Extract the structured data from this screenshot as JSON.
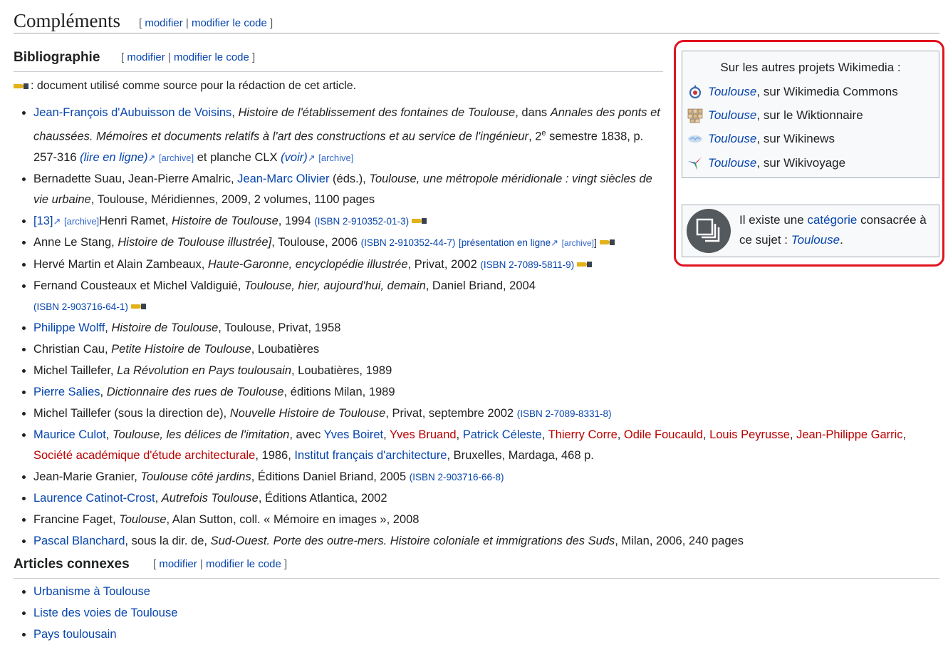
{
  "complements": {
    "title": "Compléments",
    "open": "[",
    "modifier": "modifier",
    "sep": "|",
    "modifier_code": "modifier le code",
    "close": "]"
  },
  "bibliographie": {
    "title": "Bibliographie",
    "open": "[",
    "modifier": "modifier",
    "sep": "|",
    "modifier_code": "modifier le code",
    "close": "]"
  },
  "note": ": document utilisé comme source pour la rédaction de cet article.",
  "items": {
    "i1": {
      "a1": "Jean-François d'Aubuisson de Voisins",
      "t1": ", ",
      "e1": "Histoire de l'établissement des fontaines de Toulouse",
      "t2": ", dans ",
      "e2": "Annales des ponts et chaussées. Mémoires et documents relatifs à l'art des constructions et au service de l'ingénieur",
      "t3": ", 2",
      "sup": "e",
      "t4": " semestre 1838, p. 257-316 ",
      "l1": "(lire en ligne)",
      "ar1": "[archive]",
      "t5": " et planche CLX ",
      "l2": "(voir)",
      "ar2": "[archive]"
    },
    "i2": {
      "t1": "Bernadette Suau, Jean-Pierre Amalric, ",
      "a1": "Jean-Marc Olivier",
      "t2": " (éds.), ",
      "e1": "Toulouse, une métropole méridionale : vingt siècles de vie urbaine",
      "t3": ", Toulouse, Méridiennes, 2009, 2 volumes, 1100 pages"
    },
    "i3": {
      "l1": "[13]",
      "ar1": "[archive]",
      "t1": "Henri Ramet, ",
      "e1": "Histoire de Toulouse",
      "t2": ", 1994 ",
      "isbn": "(ISBN 2-910352-01-3)"
    },
    "i4": {
      "t1": "Anne Le Stang, ",
      "e1": "Histoire de Toulouse illustrée]",
      "t2": ", Toulouse, 2006 ",
      "isbn": "(ISBN 2-910352-44-7)",
      "pres": "[présentation en ligne",
      "ar1": "[archive]",
      "close": "]"
    },
    "i5": {
      "t1": "Hervé Martin et Alain Zambeaux, ",
      "e1": "Haute-Garonne, encyclopédie illustrée",
      "t2": ", Privat, 2002 ",
      "isbn": "(ISBN 2-7089-5811-9)"
    },
    "i6": {
      "t1": "Fernand Cousteaux et Michel Valdiguié, ",
      "e1": "Toulouse, hier, aujourd'hui, demain",
      "t2": ", Daniel Briand, 2004",
      "isbn": "(ISBN 2-903716-64-1)"
    },
    "i7": {
      "a1": "Philippe Wolff",
      "t1": ", ",
      "e1": "Histoire de Toulouse",
      "t2": ", Toulouse, Privat, 1958"
    },
    "i8": {
      "t1": "Christian Cau, ",
      "e1": "Petite Histoire de Toulouse",
      "t2": ", Loubatières"
    },
    "i9": {
      "t1": "Michel Taillefer, ",
      "e1": "La Révolution en Pays toulousain",
      "t2": ", Loubatières, 1989"
    },
    "i10": {
      "a1": "Pierre Salies",
      "t1": ", ",
      "e1": "Dictionnaire des rues de Toulouse",
      "t2": ", éditions Milan, 1989"
    },
    "i11": {
      "t1": "Michel Taillefer (sous la direction de), ",
      "e1": "Nouvelle Histoire de Toulouse",
      "t2": ", Privat, septembre 2002 ",
      "isbn": "(ISBN 2-7089-8331-8)"
    },
    "i12": {
      "a1": "Maurice Culot",
      "t1": ", ",
      "e1": "Toulouse, les délices de l'imitation",
      "t2": ", avec ",
      "a2": "Yves Boiret",
      "c1": ", ",
      "r1": "Yves Bruand",
      "c2": ", ",
      "a3": "Patrick Céleste",
      "c3": ", ",
      "r2": "Thierry Corre",
      "c4": ", ",
      "r3": "Odile Foucauld",
      "c5": ", ",
      "r4": "Louis Peyrusse",
      "c6": ", ",
      "r5": "Jean-Philippe Garric",
      "c7": ", ",
      "r6": "Société académique d'étude architecturale",
      "t3": ", 1986, ",
      "a4": "Institut français d'architecture",
      "t4": ", Bruxelles, Mardaga, 468 p."
    },
    "i13": {
      "t1": "Jean-Marie Granier, ",
      "e1": "Toulouse côté jardins",
      "t2": ", Éditions Daniel Briand, 2005 ",
      "isbn": "(ISBN 2-903716-66-8)"
    },
    "i14": {
      "a1": "Laurence Catinot-Crost",
      "t1": ", ",
      "e1": "Autrefois Toulouse",
      "t2": ", Éditions Atlantica, 2002"
    },
    "i15": {
      "t1": "Francine Faget, ",
      "e1": "Toulouse",
      "t2": ", Alan Sutton, coll. « Mémoire en images », 2008"
    },
    "i16": {
      "a1": "Pascal Blanchard",
      "t1": ", sous la dir. de, ",
      "e1": "Sud-Ouest. Porte des outre-mers. Histoire coloniale et immigrations des Suds",
      "t2": ", Milan, 2006, 240 pages"
    }
  },
  "wikimedia": {
    "title": "Sur les autres projets Wikimedia :",
    "projects": [
      {
        "link": "Toulouse",
        "text": ", sur Wikimedia Commons",
        "icon": "commons-icon"
      },
      {
        "link": "Toulouse",
        "text": ", sur le Wiktionnaire",
        "icon": "wiktionary-icon"
      },
      {
        "link": "Toulouse",
        "text": ", sur Wikinews",
        "icon": "wikinews-icon"
      },
      {
        "link": "Toulouse",
        "text": ", sur Wikivoyage",
        "icon": "wikivoyage-icon"
      }
    ]
  },
  "category": {
    "t1": "Il existe une ",
    "link": "catégorie",
    "t2": " consacrée à ce sujet : ",
    "link2": "Toulouse",
    "t3": ".",
    "icon": "category-icon"
  },
  "articles": {
    "title": "Articles connexes",
    "open": "[",
    "modifier": "modifier",
    "sep": "|",
    "modifier_code": "modifier le code",
    "close": "]",
    "list": [
      "Urbanisme à Toulouse",
      "Liste des voies de Toulouse",
      "Pays toulousain"
    ]
  },
  "colors": {
    "link": "#0645ad",
    "redlink": "#ba0000",
    "highlight": "#e0131f"
  }
}
